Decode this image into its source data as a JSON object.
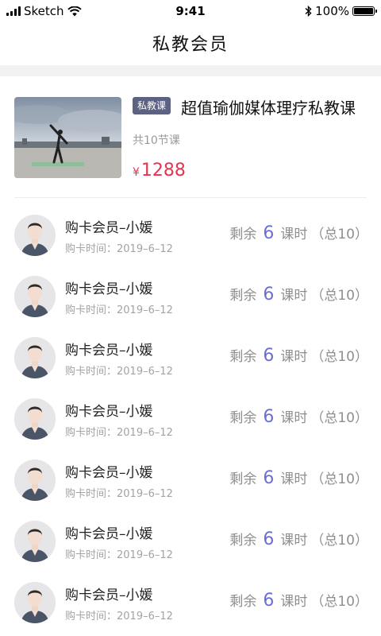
{
  "status_bar": {
    "carrier": "Sketch",
    "time": "9:41",
    "battery": "100%"
  },
  "header": {
    "title": "私教会员"
  },
  "course": {
    "tag": "私教课",
    "title": "超值瑜伽媒体理疗私教课",
    "lessons": "共10节课",
    "currency": "¥",
    "price": "1288"
  },
  "members": [
    {
      "name": "购卡会员–小媛",
      "date": "购卡时间：2019–6–12",
      "remain_label": "剩余",
      "remain": "6",
      "unit": "课时",
      "total": "（总10）"
    },
    {
      "name": "购卡会员–小媛",
      "date": "购卡时间：2019–6–12",
      "remain_label": "剩余",
      "remain": "6",
      "unit": "课时",
      "total": "（总10）"
    },
    {
      "name": "购卡会员–小媛",
      "date": "购卡时间：2019–6–12",
      "remain_label": "剩余",
      "remain": "6",
      "unit": "课时",
      "total": "（总10）"
    },
    {
      "name": "购卡会员–小媛",
      "date": "购卡时间：2019–6–12",
      "remain_label": "剩余",
      "remain": "6",
      "unit": "课时",
      "total": "（总10）"
    },
    {
      "name": "购卡会员–小媛",
      "date": "购卡时间：2019–6–12",
      "remain_label": "剩余",
      "remain": "6",
      "unit": "课时",
      "total": "（总10）"
    },
    {
      "name": "购卡会员–小媛",
      "date": "购卡时间：2019–6–12",
      "remain_label": "剩余",
      "remain": "6",
      "unit": "课时",
      "total": "（总10）"
    },
    {
      "name": "购卡会员–小媛",
      "date": "购卡时间：2019–6–12",
      "remain_label": "剩余",
      "remain": "6",
      "unit": "课时",
      "total": "（总10）"
    }
  ],
  "colors": {
    "price": "#e8324f",
    "tag_bg": "#5d6282",
    "remain_number": "#6b6fd1"
  },
  "icons": [
    "signal-icon",
    "wifi-icon",
    "bluetooth-icon",
    "battery-icon"
  ]
}
